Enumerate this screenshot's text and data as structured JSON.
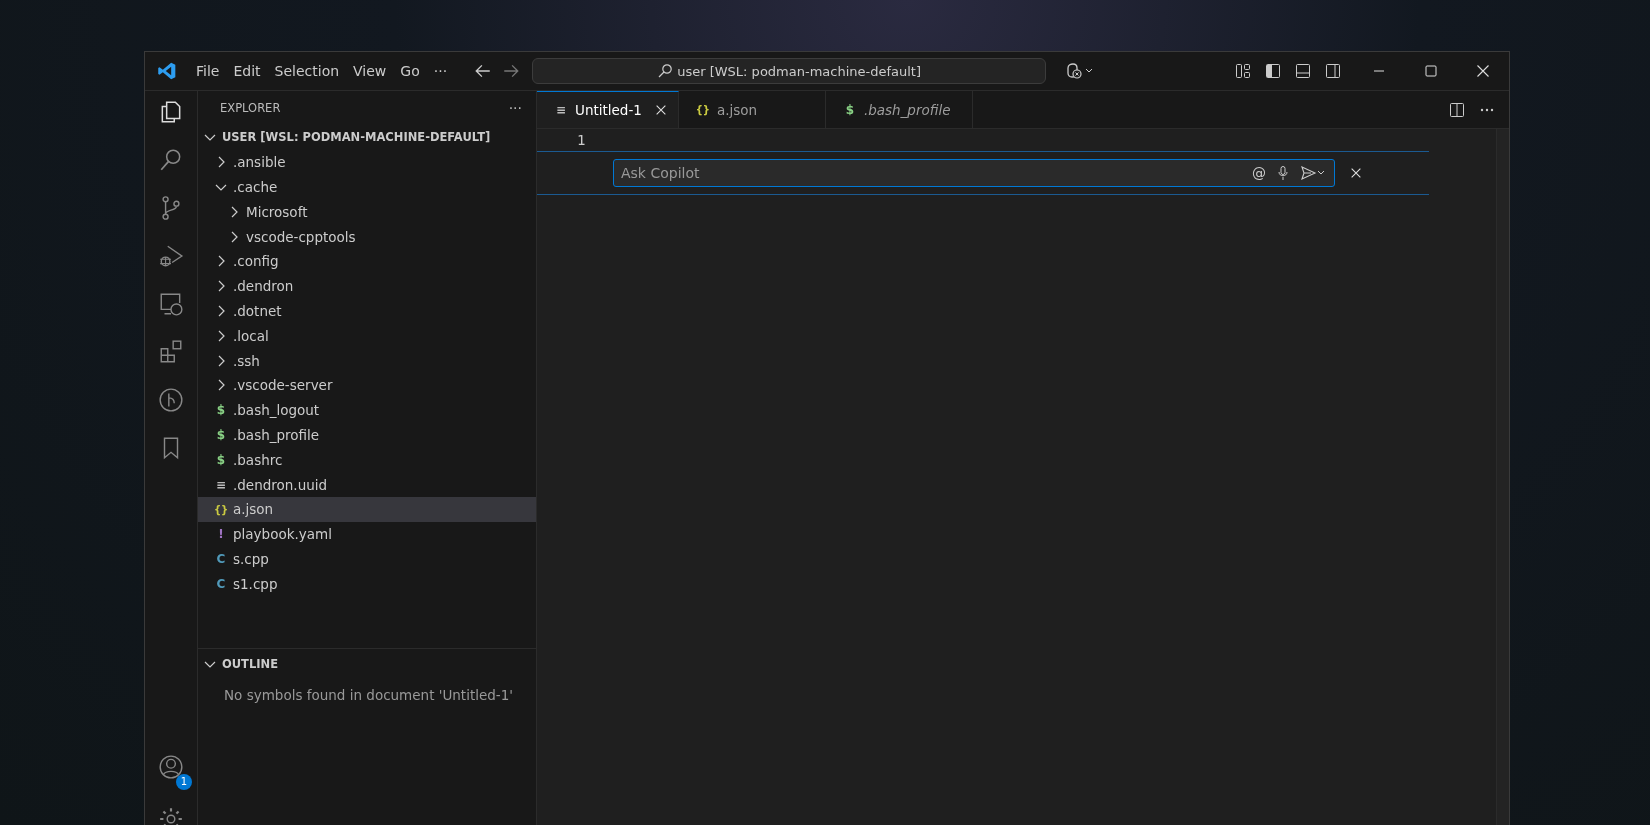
{
  "menu": [
    "File",
    "Edit",
    "Selection",
    "View",
    "Go"
  ],
  "menu_more": "···",
  "command_center": {
    "text": "user [WSL: podman-machine-default]"
  },
  "sidebar": {
    "title": "EXPLORER",
    "more": "···",
    "root": {
      "label": "USER [WSL: PODMAN-MACHINE-DEFAULT]",
      "expanded": true,
      "children": [
        {
          "label": ".ansible",
          "kind": "folder",
          "expanded": false,
          "selected": false
        },
        {
          "label": ".cache",
          "kind": "folder",
          "expanded": true,
          "selected": false,
          "children": [
            {
              "label": "Microsoft",
              "kind": "folder",
              "expanded": false,
              "selected": false
            },
            {
              "label": "vscode-cpptools",
              "kind": "folder",
              "expanded": false,
              "selected": false
            }
          ]
        },
        {
          "label": ".config",
          "kind": "folder",
          "expanded": false,
          "selected": false
        },
        {
          "label": ".dendron",
          "kind": "folder",
          "expanded": false,
          "selected": false
        },
        {
          "label": ".dotnet",
          "kind": "folder",
          "expanded": false,
          "selected": false
        },
        {
          "label": ".local",
          "kind": "folder",
          "expanded": false,
          "selected": false
        },
        {
          "label": ".ssh",
          "kind": "folder",
          "expanded": false,
          "selected": false
        },
        {
          "label": ".vscode-server",
          "kind": "folder",
          "expanded": false,
          "selected": false
        },
        {
          "label": ".bash_logout",
          "kind": "shell",
          "icon": "$",
          "selected": false
        },
        {
          "label": ".bash_profile",
          "kind": "shell",
          "icon": "$",
          "selected": false
        },
        {
          "label": ".bashrc",
          "kind": "shell",
          "icon": "$",
          "selected": false
        },
        {
          "label": ".dendron.uuid",
          "kind": "text",
          "icon": "≡",
          "selected": false
        },
        {
          "label": "a.json",
          "kind": "json",
          "icon": "{}",
          "selected": true
        },
        {
          "label": "playbook.yaml",
          "kind": "yaml",
          "icon": "!",
          "selected": false
        },
        {
          "label": "s.cpp",
          "kind": "cpp",
          "icon": "C",
          "selected": false
        },
        {
          "label": "s1.cpp",
          "kind": "cpp",
          "icon": "C",
          "selected": false
        }
      ]
    },
    "outline": {
      "title": "OUTLINE",
      "expanded": true,
      "message": "No symbols found in document 'Untitled-1'"
    }
  },
  "accounts_badge": "1",
  "tabs": [
    {
      "label": "Untitled-1",
      "kind": "text",
      "icon": "≡",
      "selected": true,
      "preview": false
    },
    {
      "label": "a.json",
      "kind": "json",
      "icon": "{}",
      "selected": false,
      "preview": false
    },
    {
      "label": ".bash_profile",
      "kind": "shell",
      "icon": "$",
      "selected": false,
      "preview": true
    }
  ],
  "editor": {
    "line_numbers": [
      "1"
    ],
    "inline_chat": {
      "placeholder": "Ask Copilot",
      "mention": "@"
    }
  }
}
